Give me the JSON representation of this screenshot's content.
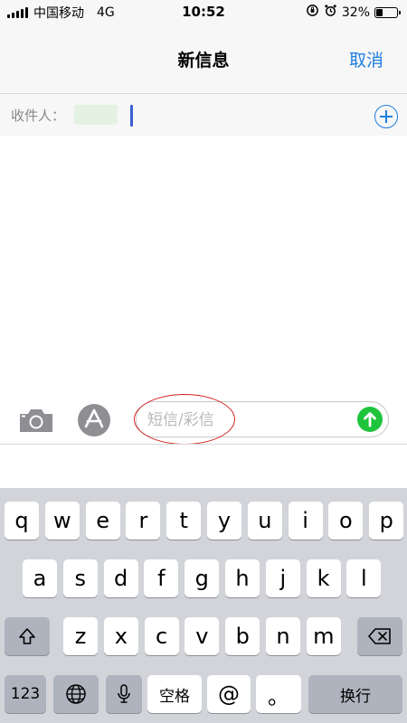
{
  "status_bar": {
    "carrier": "中国移动",
    "network": "4G",
    "time": "10:52",
    "battery_percent": "32%",
    "battery_level": 0.32
  },
  "nav": {
    "title": "新信息",
    "cancel_label": "取消"
  },
  "recipient": {
    "label": "收件人："
  },
  "compose": {
    "placeholder": "短信/彩信",
    "icons": {
      "camera": "camera-icon",
      "appstore": "appstore-icon",
      "send": "send-arrow-icon",
      "add_contact": "plus-circle-icon"
    }
  },
  "keyboard": {
    "row1": [
      "q",
      "w",
      "e",
      "r",
      "t",
      "y",
      "u",
      "i",
      "o",
      "p"
    ],
    "row2": [
      "a",
      "s",
      "d",
      "f",
      "g",
      "h",
      "j",
      "k",
      "l"
    ],
    "row3": [
      "z",
      "x",
      "c",
      "v",
      "b",
      "n",
      "m"
    ],
    "numbers_label": "123",
    "space_label": "空格",
    "at_label": "@",
    "period_label": "。",
    "return_label": "换行",
    "icons": {
      "shift": "shift-icon",
      "delete": "delete-icon",
      "globe": "globe-icon",
      "mic": "microphone-icon"
    }
  },
  "colors": {
    "accent": "#1e7ee0",
    "send": "#1fc43c",
    "annotation": "#d42020",
    "keyboard_bg": "#d2d4da"
  }
}
